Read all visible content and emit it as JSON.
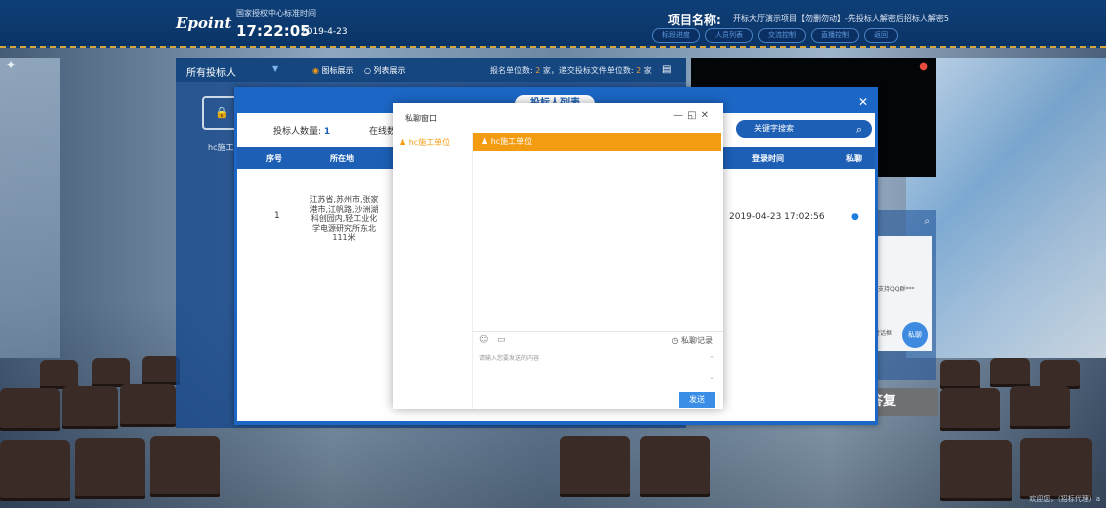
{
  "header": {
    "logo": "Epoint",
    "center_name": "国家授权中心标准时间",
    "clock": "17:22:05",
    "date": "2019-4-23",
    "project_label": "项目名称:",
    "project_name": "开标大厅演示项目【勿删勿动】-先投标人解密后招标人解密5",
    "nav": [
      "标段进度",
      "人员列表",
      "交流控制",
      "直播控制",
      "返回"
    ]
  },
  "panel": {
    "dropdown": "所有投标人",
    "view_icon": "图标展示",
    "view_list": "列表展示",
    "stats_prefix": "报名单位数:",
    "stats_reg": "2",
    "stats_mid": "家，递交投标文件单位数:",
    "stats_sub": "2",
    "stats_suffix": "家",
    "folder_label": "hc施工"
  },
  "dialog": {
    "tab": "投标人列表",
    "count_label": "投标人数量:",
    "count_value": "1",
    "online_label": "在线数",
    "search_placeholder": "关键字搜索",
    "columns": {
      "index": "序号",
      "location": "所在地",
      "login_time": "登录时间",
      "private_chat": "私聊"
    },
    "rows": [
      {
        "index": "1",
        "location": "江苏省,苏州市,张家港市,江帆路,沙洲湖科创园内,轻工业化学电源研究所东北111米",
        "login_time": "2019-04-23 17:02:56"
      }
    ]
  },
  "private_chat": {
    "title": "私聊窗口",
    "contact": "hc施工单位",
    "active_contact": "hc施工单位",
    "history": "私聊记录",
    "placeholder": "请输入您要发送的内容",
    "send": "发送"
  },
  "side": {
    "qq_hint": "不支持QQ群***",
    "dialog_hint": "对话框",
    "private_button": "私聊",
    "reply": "答复"
  },
  "footer": "欢迎您，（招标代理）a",
  "colors": {
    "brand": "#1c5fb5",
    "accent": "#f39c12",
    "send": "#3a8ee6"
  }
}
